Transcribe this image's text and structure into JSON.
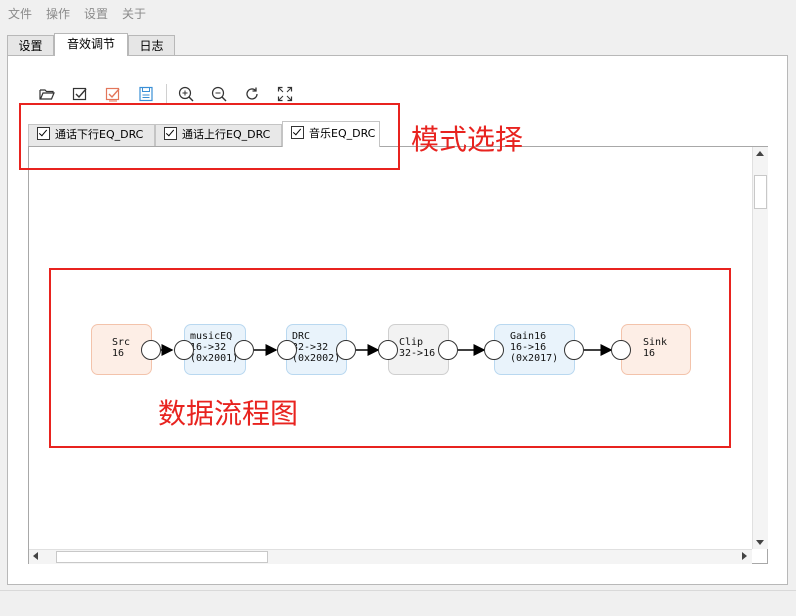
{
  "menu": [
    "文件",
    "操作",
    "设置",
    "关于"
  ],
  "main_tabs": [
    "设置",
    "音效调节",
    "日志"
  ],
  "toolbar": {
    "icons": [
      "folder-open-icon",
      "check-icon",
      "edit-check-icon",
      "save-doc-icon",
      "zoom-in-icon",
      "zoom-out-icon",
      "refresh-icon",
      "fit-screen-icon"
    ]
  },
  "mode_tabs": [
    {
      "label": "通话下行EQ_DRC",
      "checked": true
    },
    {
      "label": "通话上行EQ_DRC",
      "checked": true
    },
    {
      "label": "音乐EQ_DRC",
      "checked": true
    }
  ],
  "annotations": {
    "mode_select": "模式选择",
    "data_flow": "数据流程图"
  },
  "graph": {
    "nodes": [
      {
        "id": "src",
        "text": "Src\n16"
      },
      {
        "id": "musiceq",
        "text": "musicEQ\n16->32\n(0x2001)"
      },
      {
        "id": "drc",
        "text": "DRC\n32->32\n(0x2002)"
      },
      {
        "id": "clip",
        "text": "Clip\n32->16"
      },
      {
        "id": "gain16",
        "text": "Gain16\n16->16\n(0x2017)"
      },
      {
        "id": "sink",
        "text": "Sink\n16"
      }
    ]
  },
  "colors": {
    "annotation": "#e8231f",
    "src_sink_fill": "#fdeee6",
    "proc_fill": "#e9f3fb",
    "clip_fill": "#f2f2f2"
  }
}
